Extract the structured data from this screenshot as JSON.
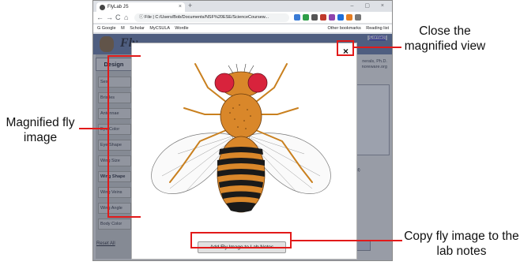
{
  "browser": {
    "tab_title": "FlyLab JS",
    "tab_close": "×",
    "new_tab": "+",
    "window_controls": "– ▢ ×",
    "nav": {
      "back": "←",
      "forward": "→",
      "reload": "C",
      "home": "⌂"
    },
    "url": "ⓘ File | C:/Users/Bob/Documents/NSF%20ESE/ScienceCoursew...",
    "bookmarks": [
      "G Google",
      "M",
      "Scholar",
      "MyCSULA",
      "Wordle"
    ],
    "bookmarks_right": [
      "Other bookmarks",
      "Reading list"
    ]
  },
  "page": {
    "title": "Fly",
    "contact_link": "Contact",
    "author_line1": "nerals, Ph.D.",
    "author_line2": "noreware.org",
    "scalloped_text": "alloped (d)",
    "design_tab": "Design",
    "sidebar_items": [
      "Sex",
      "Bristles",
      "Antennae",
      "Eye Color",
      "Eye Shape",
      "Wing Size",
      "Wing Shape",
      "Wing Veins",
      "Wing Angle",
      "Body Color"
    ],
    "reset_all": "Reset All"
  },
  "modal": {
    "close_label": "×",
    "add_button_label": "Add Fly Image to Lab Notes"
  },
  "callouts": {
    "close": "Close the magnified view",
    "magnified": "Magnified fly image",
    "copy": "Copy fly image to the lab notes"
  },
  "colors": {
    "annotation_red": "#e21a1a",
    "body_orange": "#d9872a",
    "eye_red": "#d8233c",
    "stripe_black": "#1a1a1a"
  }
}
